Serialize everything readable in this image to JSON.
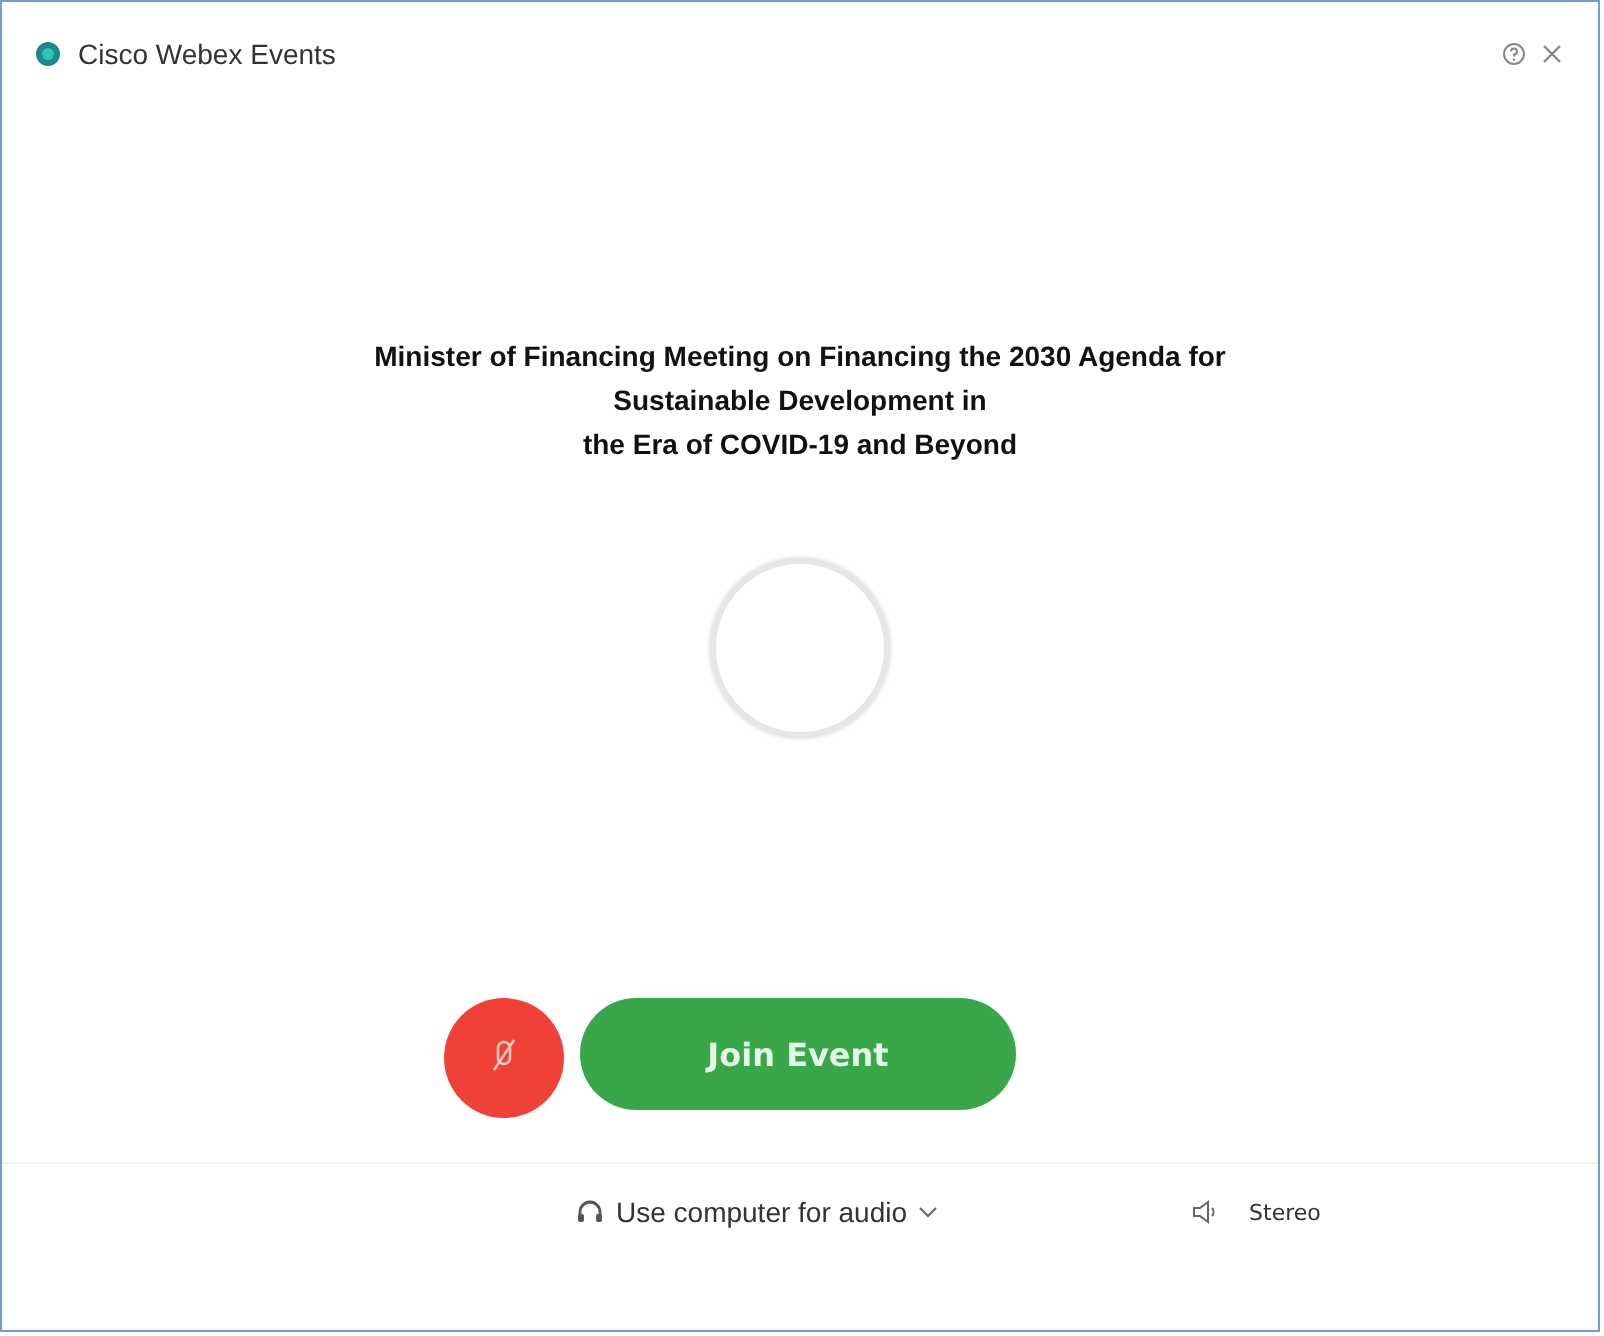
{
  "window": {
    "title": "Cisco Webex Events"
  },
  "heading_lines": [
    "Minister of Financing Meeting on Financing the 2030 Agenda for",
    "Sustainable Development in",
    "the Era of COVID-19 and Beyond"
  ],
  "microphone": {
    "muted": true
  },
  "join_button": {
    "label": "Join Event"
  },
  "audio": {
    "label": "Use computer for audio",
    "speaker_label": "Stereo"
  }
}
